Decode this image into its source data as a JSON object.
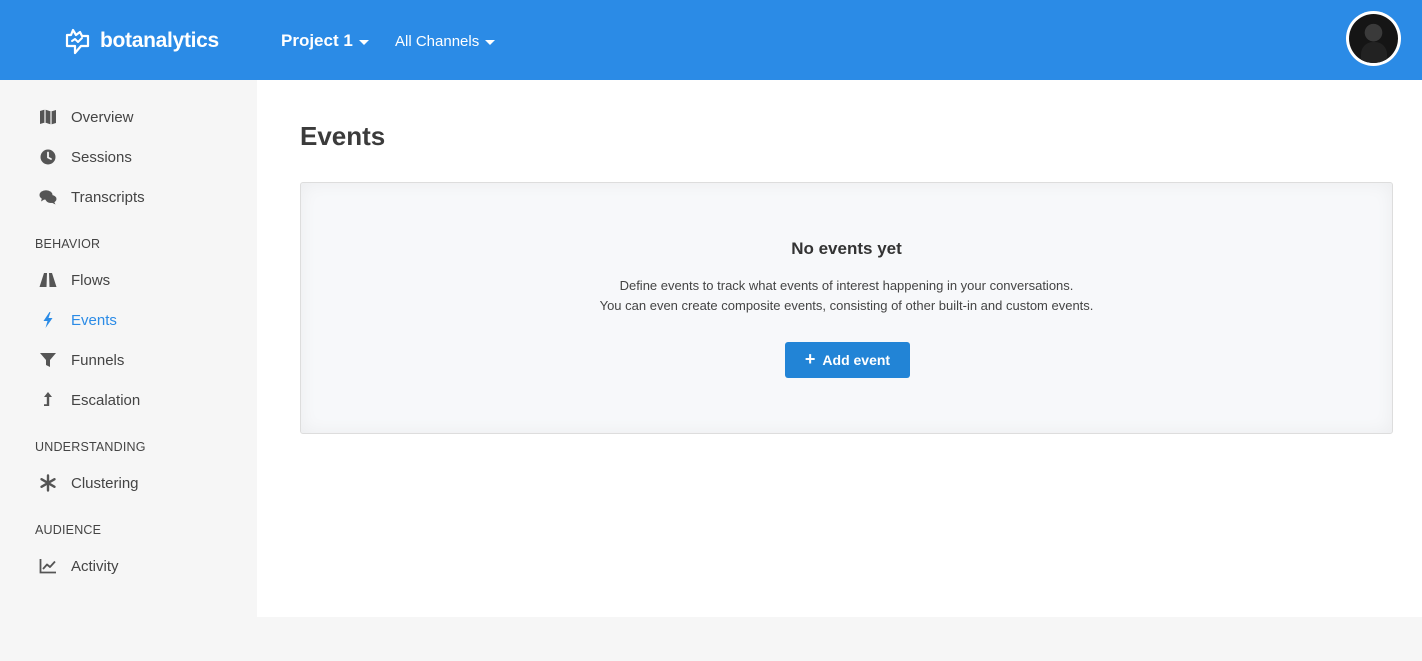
{
  "header": {
    "brand": "botanalytics",
    "project": "Project 1",
    "channels": "All Channels",
    "accent_color": "#2b8be6"
  },
  "sidebar": {
    "items_top": [
      {
        "label": "Overview",
        "icon": "map-icon"
      },
      {
        "label": "Sessions",
        "icon": "clock-icon"
      },
      {
        "label": "Transcripts",
        "icon": "comments-icon"
      }
    ],
    "sections": [
      {
        "title": "BEHAVIOR",
        "items": [
          {
            "label": "Flows",
            "icon": "road-icon"
          },
          {
            "label": "Events",
            "icon": "bolt-icon",
            "active": true
          },
          {
            "label": "Funnels",
            "icon": "filter-icon"
          },
          {
            "label": "Escalation",
            "icon": "level-up-icon"
          }
        ]
      },
      {
        "title": "UNDERSTANDING",
        "items": [
          {
            "label": "Clustering",
            "icon": "asterisk-icon"
          }
        ]
      },
      {
        "title": "AUDIENCE",
        "items": [
          {
            "label": "Activity",
            "icon": "line-chart-icon"
          }
        ]
      }
    ]
  },
  "main": {
    "title": "Events",
    "empty": {
      "title": "No events yet",
      "line1": "Define events to track what events of interest happening in your conversations.",
      "line2": "You can even create composite events, consisting of other built-in and custom events.",
      "button": "Add event"
    }
  }
}
